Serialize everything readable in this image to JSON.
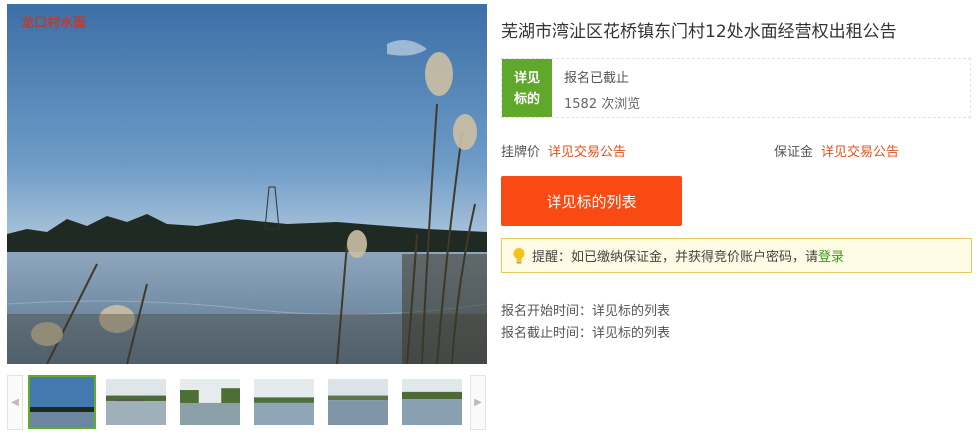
{
  "gallery": {
    "watermark": "龙口村水面",
    "main_image_alt": "lake",
    "prev_arrow": "◀",
    "next_arrow": "▶",
    "thumbnails": 6
  },
  "listing": {
    "title": "芜湖市湾沚区花桥镇东门村12处水面经营权出租公告",
    "status_tag_line1": "详见",
    "status_tag_line2": "标的",
    "status_text": "报名已截止",
    "views_count": "1582",
    "views_unit": "次浏览",
    "price_label": "挂牌价",
    "price_value": "详见交易公告",
    "deposit_label": "保证金",
    "deposit_value": "详见交易公告",
    "button_label": "详见标的列表",
    "tip_prefix": "提醒：如已缴纳保证金，并获得竞价账户密码，请",
    "tip_login": "登录",
    "start_time": "报名开始时间：详见标的列表",
    "end_time": "报名截止时间：详见标的列表"
  },
  "colors": {
    "accent_green": "#5fa82b",
    "button_orange": "#fa4a13",
    "link_orange": "#e5501a",
    "login_green": "#3a9b1d",
    "tip_background": "#fdfbe3",
    "tip_border": "#e4c95e"
  }
}
